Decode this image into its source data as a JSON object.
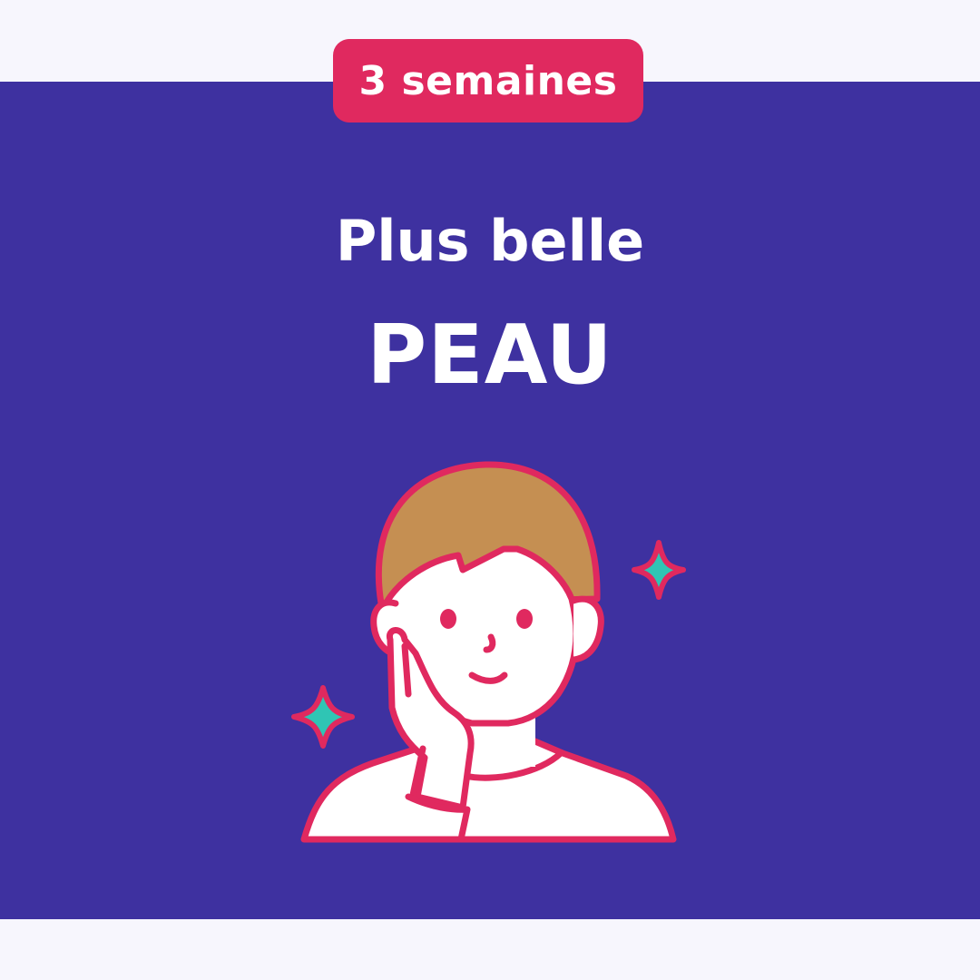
{
  "badge": {
    "label": "3 semaines"
  },
  "heading": {
    "line1": "Plus belle",
    "line2": "PEAU"
  },
  "colors": {
    "page_background": "#f7f6fd",
    "panel": "#3e31a0",
    "accent": "#e0295f",
    "hair": "#c58f52",
    "sparkle_fill": "#2fc5b4",
    "text": "#ffffff"
  },
  "illustration": {
    "icon": "person-hand-on-cheek-icon"
  }
}
